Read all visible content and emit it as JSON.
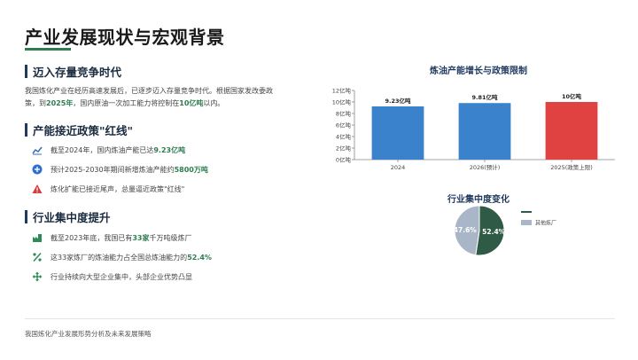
{
  "page": {
    "title": "产业发展现状与宏观背景",
    "footer": "我国炼化产业发展形势分析及未来发展策略"
  },
  "section1": {
    "heading": "迈入存量竞争时代",
    "para_1": "我国炼化产业在经历高速发展后，已逐步迈入存量竞争时代。根据国家发改委政",
    "para_2a": "策，到",
    "para_2b": "2025年",
    "para_2c": "，国内原油一次加工能力将控制在",
    "para_2d": "10亿吨",
    "para_2e": "以内。"
  },
  "section2": {
    "heading": "产能接近政策\"红线\"",
    "bullets": [
      {
        "icon": "line-chart-icon",
        "text": "截至2024年，国内炼油产能已达",
        "bold": "9.23亿吨"
      },
      {
        "icon": "plus-circle-icon",
        "text": "预计2025-2030年期间新增炼油产能约",
        "bold": "5800万吨"
      },
      {
        "icon": "warning-icon",
        "text": "炼化扩能已接近尾声，总量逼近政策\"红线\"",
        "bold": ""
      }
    ]
  },
  "section3": {
    "heading": "行业集中度提升",
    "bullets": [
      {
        "icon": "factory-icon",
        "text": "截至2023年底，我国已有",
        "bold": "33家",
        "after": "千万吨级炼厂"
      },
      {
        "icon": "percent-icon",
        "text": "这33家炼厂的炼油能力占全国总炼油能力的",
        "bold": "52.4%",
        "after": ""
      },
      {
        "icon": "arrows-converge-icon",
        "text": "行业持续向大型企业集中，头部企业优势凸显",
        "bold": "",
        "after": ""
      }
    ]
  },
  "colors": {
    "accent_green": "#2e7d4f",
    "bar_blue": "#3a83cc",
    "bar_red": "#e04141",
    "pie_dark": "#2f5a45",
    "pie_grey": "#a9b6c8"
  },
  "chart_data": [
    {
      "type": "bar",
      "title": "炼油产能增长与政策限制",
      "categories": [
        "2024",
        "2026(预计)",
        "2025(政策上限)"
      ],
      "values": [
        9.23,
        9.81,
        10
      ],
      "data_labels": [
        "9.23亿吨",
        "9.81亿吨",
        "10亿吨"
      ],
      "bar_colors": [
        "#3a83cc",
        "#3a83cc",
        "#e04141"
      ],
      "y_ticks": [
        "0亿吨",
        "2亿吨",
        "4亿吨",
        "6亿吨",
        "8亿吨",
        "10亿吨",
        "12亿吨"
      ],
      "ylim": [
        0,
        12
      ],
      "grid": false
    },
    {
      "type": "pie",
      "title": "行业集中度变化",
      "slices": [
        {
          "label": "",
          "value": 52.4,
          "color": "#2f5a45",
          "display": "52.4%"
        },
        {
          "label": "其他炼厂",
          "value": 47.6,
          "color": "#a9b6c8",
          "display": "47.6%"
        }
      ],
      "legend": [
        "",
        "其他炼厂"
      ],
      "legend_position": "right"
    }
  ]
}
